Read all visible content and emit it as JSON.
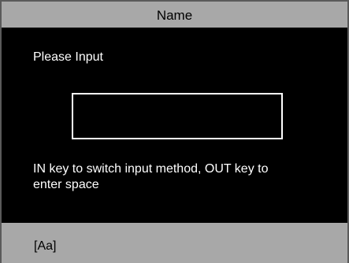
{
  "window": {
    "title": "Name"
  },
  "dialog": {
    "prompt": "Please Input",
    "input_value": "",
    "hint": "IN key to switch input method, OUT key to enter space"
  },
  "status": {
    "input_method": "[Aa]"
  },
  "colors": {
    "bar_background": "#a8a8a8",
    "screen_background": "#000000",
    "text_on_screen": "#ffffff",
    "text_on_bar": "#000000"
  }
}
